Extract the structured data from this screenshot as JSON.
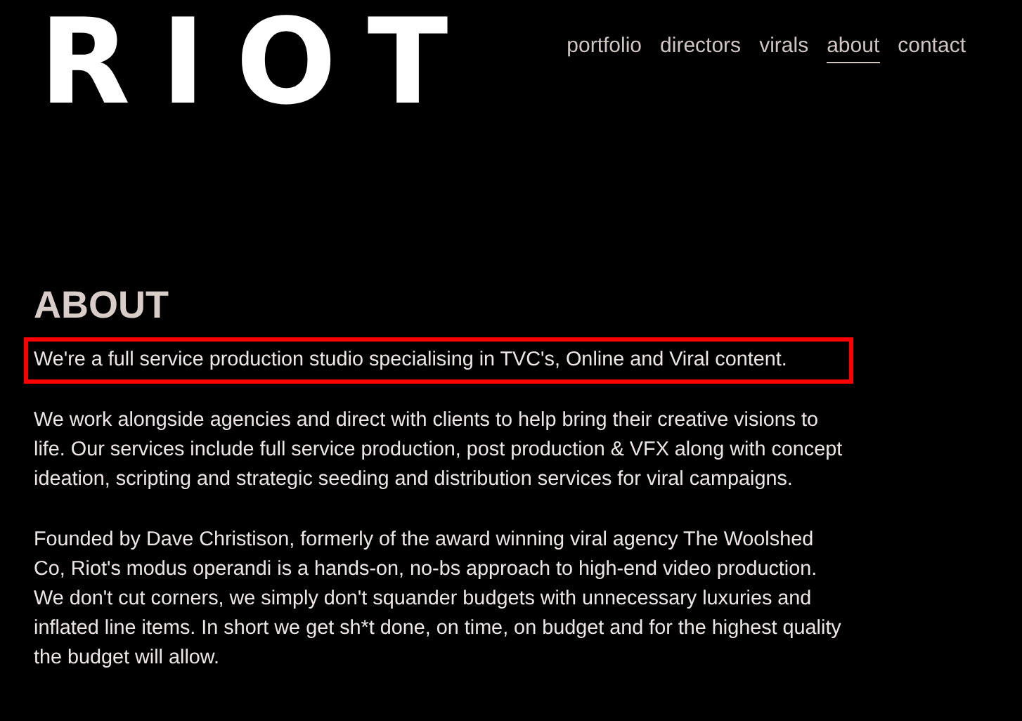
{
  "logo": "RIOT",
  "nav": [
    {
      "label": "portfolio",
      "selected": false
    },
    {
      "label": "directors",
      "selected": false
    },
    {
      "label": "virals",
      "selected": false
    },
    {
      "label": "about",
      "selected": true
    },
    {
      "label": "contact",
      "selected": false
    }
  ],
  "heading": "ABOUT",
  "paragraphs": [
    {
      "text": "We're a full service production studio specialising in TVC's, Online and Viral content.",
      "highlighted": true
    },
    {
      "text": "We work alongside agencies and direct with clients to help bring their creative visions to life. Our services include full service production, post production & VFX along with concept ideation, scripting and strategic seeding and distribution services for viral campaigns.",
      "highlighted": false
    },
    {
      "text": "Founded by Dave Christison, formerly of the award winning viral agency The Woolshed Co, Riot's modus operandi is a hands-on, no-bs approach to high-end video production. We don't cut corners, we simply don't squander budgets with unnecessary luxuries and inflated line items. In short we get sh*t done, on time, on budget and for the highest quality the budget will allow.",
      "highlighted": false
    }
  ]
}
